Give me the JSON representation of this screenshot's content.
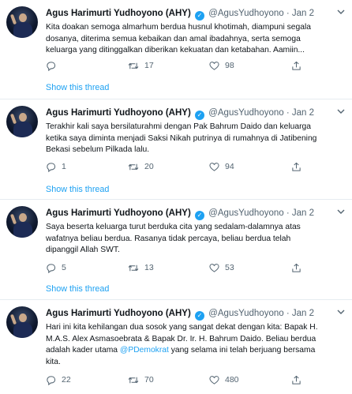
{
  "account": {
    "name": "Agus Harimurti Yudhoyono (AHY)",
    "handle": "@AgusYudhoyono",
    "separator": "·",
    "verified_glyph": "✓"
  },
  "colors": {
    "accent": "#1da1f2",
    "muted": "#536471",
    "border": "#e6ecf0"
  },
  "tweets": [
    {
      "date": "Jan 2",
      "text": "Kita doakan semoga almarhum berdua husnul khotimah, diampuni segala\ndosanya, diterima semua kebaikan dan amal ibadahnya, serta semoga\nkeluarga yang ditinggalkan diberikan kekuatan dan ketabahan. Aamiin...",
      "replies": "",
      "retweets": "17",
      "likes": "98",
      "show_thread": "Show this thread"
    },
    {
      "date": "Jan 2",
      "text": "Terakhir kali saya bersilaturahmi dengan Pak Bahrum Daido dan keluarga\nketika saya diminta menjadi Saksi Nikah putrinya di rumahnya di Jatibening\nBekasi sebelum Pilkada lalu.",
      "replies": "1",
      "retweets": "20",
      "likes": "94",
      "show_thread": "Show this thread"
    },
    {
      "date": "Jan 2",
      "text": "Saya beserta keluarga turut berduka cita yang sedalam-dalamnya atas\nwafatnya beliau berdua. Rasanya tidak percaya, beliau berdua telah\ndipanggil Allah SWT.",
      "replies": "5",
      "retweets": "13",
      "likes": "53",
      "show_thread": "Show this thread"
    },
    {
      "date": "Jan 2",
      "text_before_mention": "Hari ini kita kehilangan dua sosok yang sangat dekat dengan kita: Bapak H.\nM.A.S. Alex Asmasoebrata & Bapak Dr. Ir. H. Bahrum Daido. Beliau berdua\nadalah kader utama ",
      "mention": "@PDemokrat",
      "text_after_mention": " yang selama ini telah berjuang bersama\nkita.",
      "replies": "22",
      "retweets": "70",
      "likes": "480"
    }
  ],
  "icons": {
    "reply": "reply-icon",
    "retweet": "retweet-icon",
    "like": "heart-icon",
    "share": "share-icon",
    "caret": "chevron-down-icon"
  }
}
